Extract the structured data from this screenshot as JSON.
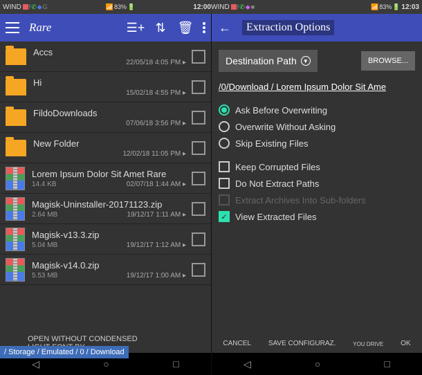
{
  "status": {
    "left": {
      "carrier": "WIND",
      "battery": "83%",
      "time": "12:00"
    },
    "right": {
      "carrier": "WIND",
      "battery": "83%",
      "time": "12:03"
    }
  },
  "left_screen": {
    "title": "Rare",
    "items": [
      {
        "type": "folder",
        "name": "Accs",
        "date": "22/05/18 4:05 PM",
        "size": ""
      },
      {
        "type": "folder",
        "name": "Hi",
        "date": "15/02/18 4:55 PM",
        "size": ""
      },
      {
        "type": "folder",
        "name": "FildoDownloads",
        "date": "07/06/18 3:56 PM",
        "size": ""
      },
      {
        "type": "folder",
        "name": "New Folder",
        "date": "12/02/18 11:05 PM",
        "size": ""
      },
      {
        "type": "zip",
        "name": "Lorem Ipsum Dolor Sit Amet Rare",
        "date": "02/07/18 1:44 AM",
        "size": "14.4 KB"
      },
      {
        "type": "zip",
        "name": "Magisk-Uninstaller-20171123.zip",
        "date": "19/12/17 1:11 AM",
        "size": "2.64 MB"
      },
      {
        "type": "zip",
        "name": "Magisk-v13.3.zip",
        "date": "19/12/17 1:12 AM",
        "size": "5.04 MB"
      },
      {
        "type": "zip",
        "name": "Magisk-v14.0.zip",
        "date": "19/12/17 1:00 AM",
        "size": "5.53 MB"
      }
    ],
    "open_msg_line1": "OPEN WITHOUT CONDENSED",
    "open_msg_line2": "LIGHT FONT BY",
    "path": "/ Storage / Emulated / 0 / Download"
  },
  "right_screen": {
    "title": "Extraction Options",
    "dest_label": "Destination Path",
    "browse": "BROWSE...",
    "path": "/0/Download / Lorem Ipsum Dolor Sit Ame",
    "radios": [
      {
        "label": "Ask Before Overwriting",
        "checked": true
      },
      {
        "label": "Overwrite Without Asking",
        "checked": false
      },
      {
        "label": "Skip Existing Files",
        "checked": false
      }
    ],
    "checks": [
      {
        "label": "Keep Corrupted Files",
        "checked": false,
        "disabled": false
      },
      {
        "label": "Do Not Extract Paths",
        "checked": false,
        "disabled": false
      },
      {
        "label": "Extract Archives Into Sub-folders",
        "checked": false,
        "disabled": true
      },
      {
        "label": "View Extracted Files",
        "checked": true,
        "disabled": false
      }
    ],
    "actions": {
      "cancel": "CANCEL",
      "save": "SAVE CONFIGURAZ.",
      "drive": "YOU DRIVE",
      "ok": "OK"
    }
  },
  "nav": {
    "back": "◁",
    "home": "○",
    "recent": "□"
  }
}
